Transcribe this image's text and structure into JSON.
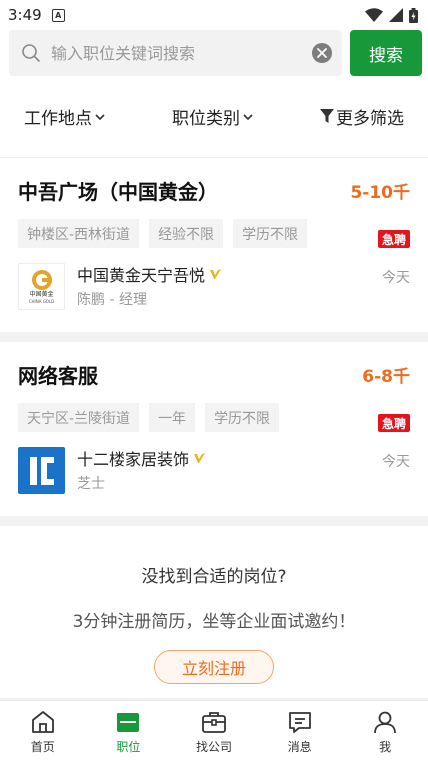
{
  "status_bar": {
    "time": "3:49",
    "notif_letter": "A"
  },
  "search": {
    "placeholder": "输入职位关键词搜索",
    "button_label": "搜索"
  },
  "filters": [
    {
      "label": "工作地点"
    },
    {
      "label": "职位类别"
    },
    {
      "label": "更多筛选"
    }
  ],
  "jobs": [
    {
      "title": "中吾广场（中国黄金）",
      "salary": "5-10千",
      "tags": [
        "钟楼区-西林街道",
        "经验不限",
        "学历不限"
      ],
      "urgent": "急聘",
      "company": "中国黄金天宁吾悦",
      "contact": "陈鹏 - 经理",
      "posted": "今天",
      "logo_text": "中国黄金",
      "logo_sub": "CHINA GOLD"
    },
    {
      "title": "网络客服",
      "salary": "6-8千",
      "tags": [
        "天宁区-兰陵街道",
        "一年",
        "学历不限"
      ],
      "urgent": "急聘",
      "company": "十二楼家居装饰",
      "contact": "芝士",
      "posted": "今天"
    }
  ],
  "register": {
    "question": "没找到合适的岗位?",
    "subtitle": "3分钟注册简历，坐等企业面试邀约！",
    "button_label": "立刻注册"
  },
  "bottom_nav": [
    {
      "label": "首页",
      "icon": "home-icon"
    },
    {
      "label": "职位",
      "icon": "briefcase-icon",
      "active": true
    },
    {
      "label": "找公司",
      "icon": "company-icon"
    },
    {
      "label": "消息",
      "icon": "message-icon"
    },
    {
      "label": "我",
      "icon": "user-icon"
    }
  ],
  "colors": {
    "brand_green": "#17993a",
    "salary_orange": "#f06a1d",
    "urgent_red": "#e5141c"
  }
}
